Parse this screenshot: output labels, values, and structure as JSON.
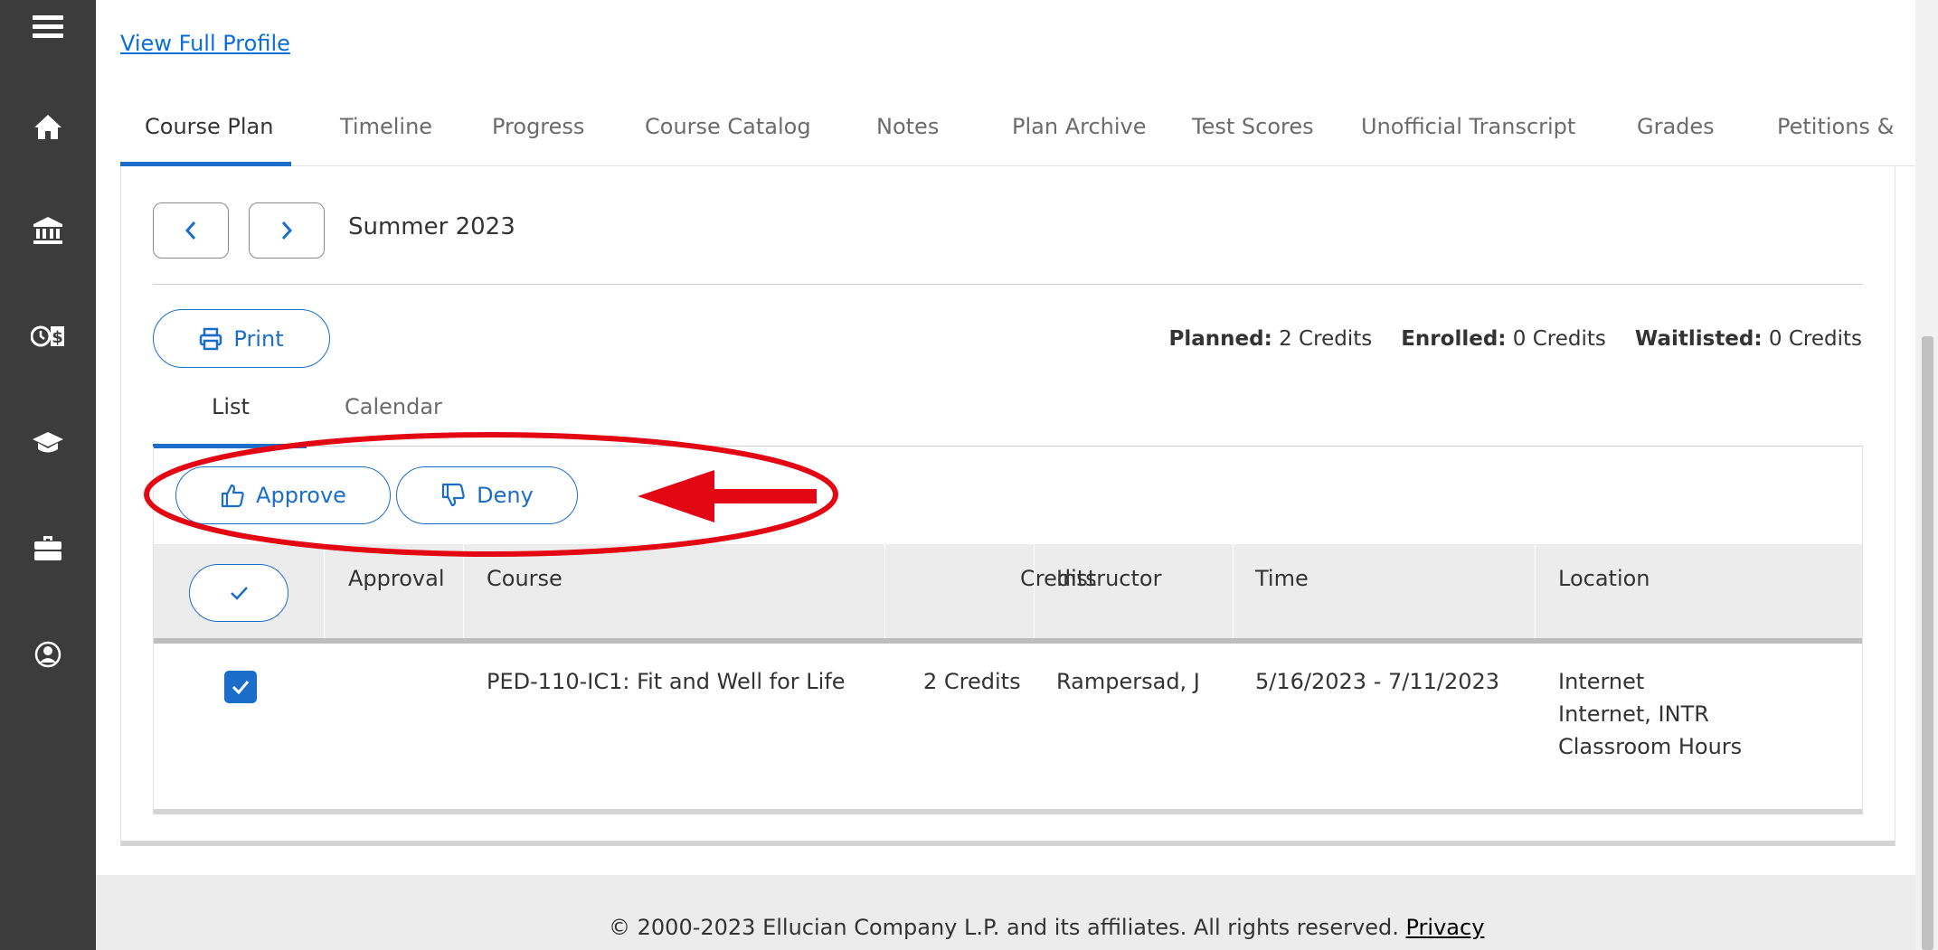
{
  "sidebar": {
    "icons": [
      "menu-icon",
      "home-icon",
      "bank-icon",
      "finance-icon",
      "graduation-cap-icon",
      "briefcase-icon",
      "user-circle-icon"
    ]
  },
  "profile_link": "View Full Profile",
  "tabs": [
    "Course Plan",
    "Timeline",
    "Progress",
    "Course Catalog",
    "Notes",
    "Plan Archive",
    "Test Scores",
    "Unofficial Transcript",
    "Grades",
    "Petitions &"
  ],
  "term": "Summer 2023",
  "print_label": "Print",
  "credits": {
    "planned_label": "Planned:",
    "planned_value": "2 Credits",
    "enrolled_label": "Enrolled:",
    "enrolled_value": "0 Credits",
    "waitlisted_label": "Waitlisted:",
    "waitlisted_value": "0 Credits"
  },
  "view_tabs": {
    "list": "List",
    "calendar": "Calendar"
  },
  "actions": {
    "approve": "Approve",
    "deny": "Deny"
  },
  "table": {
    "headers": {
      "approval": "Approval",
      "course": "Course",
      "credits": "Credits",
      "instructor": "Instructor",
      "time": "Time",
      "location": "Location"
    },
    "row": {
      "course": "PED-110-IC1: Fit and Well for Life",
      "credits": "2 Credits",
      "instructor": "Rampersad, J",
      "time": "5/16/2023 - 7/11/2023",
      "location_1": "Internet",
      "location_2": "Internet, INTR",
      "location_3": "Classroom Hours"
    }
  },
  "footer": {
    "copyright": "© 2000-2023 Ellucian Company L.P. and its affiliates. All rights reserved.",
    "privacy": "Privacy"
  },
  "colors": {
    "accent": "#1a6ec9",
    "sidebar": "#3c3c3c",
    "annotation": "#e30613"
  }
}
